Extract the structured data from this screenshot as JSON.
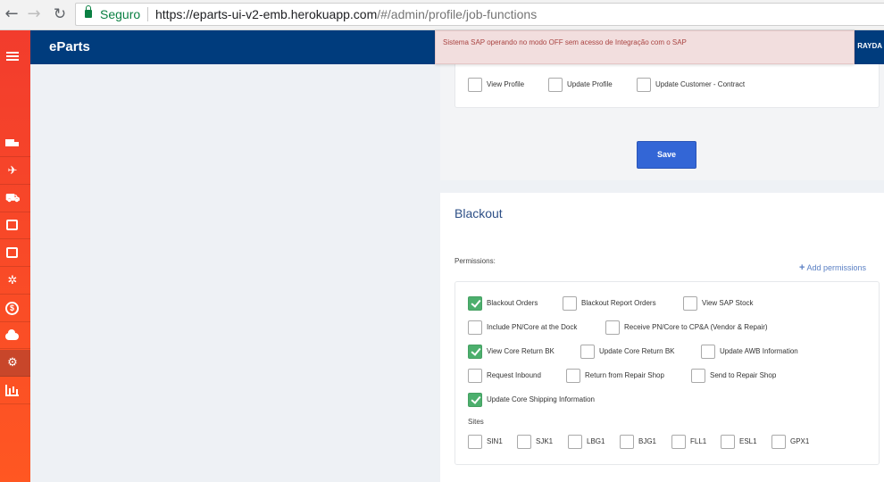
{
  "browser": {
    "secure_label": "Seguro",
    "url_host": "https://eparts-ui-v2-emb.herokuapp.com",
    "url_path": "/#/admin/profile/job-functions"
  },
  "header": {
    "logo": "eParts",
    "user": "RAYDA"
  },
  "alert": {
    "message": "Sistema SAP operando no modo OFF sem acesso de Integração com o SAP"
  },
  "sidebar": {
    "items": [
      {
        "icon": "truck-icon"
      },
      {
        "icon": "plane-icon"
      },
      {
        "icon": "cart-icon"
      },
      {
        "icon": "document-icon"
      },
      {
        "icon": "box-icon"
      },
      {
        "icon": "network-icon"
      },
      {
        "icon": "dollar-icon"
      },
      {
        "icon": "cloud-icon"
      },
      {
        "icon": "cogs-icon",
        "active": true
      },
      {
        "icon": "bar-chart-icon"
      }
    ]
  },
  "top_card": {
    "items": [
      {
        "label": "View Profile",
        "checked": false
      },
      {
        "label": "Update Profile",
        "checked": false
      },
      {
        "label": "Update Customer - Contract",
        "checked": false
      }
    ],
    "save_label": "Save"
  },
  "blackout": {
    "title": "Blackout",
    "permissions_label": "Permissions:",
    "add_permissions": "Add permissions",
    "permissions": [
      {
        "label": "Blackout Orders",
        "checked": true
      },
      {
        "label": "Blackout Report Orders",
        "checked": false
      },
      {
        "label": "View SAP Stock",
        "checked": false
      },
      {
        "label": "Include PN/Core at the Dock",
        "checked": false
      },
      {
        "label": "Receive PN/Core to CP&A (Vendor & Repair)",
        "checked": false
      },
      {
        "label": "View Core Return BK",
        "checked": true
      },
      {
        "label": "Update Core Return BK",
        "checked": false
      },
      {
        "label": "Update AWB Information",
        "checked": false
      },
      {
        "label": "Request Inbound",
        "checked": false
      },
      {
        "label": "Return from Repair Shop",
        "checked": false
      },
      {
        "label": "Send to Repair Shop",
        "checked": false
      },
      {
        "label": "Update Core Shipping Information",
        "checked": true
      }
    ],
    "sites_label": "Sites",
    "sites": [
      {
        "label": "SIN1",
        "checked": false
      },
      {
        "label": "SJK1",
        "checked": false
      },
      {
        "label": "LBG1",
        "checked": false
      },
      {
        "label": "BJG1",
        "checked": false
      },
      {
        "label": "FLL1",
        "checked": false
      },
      {
        "label": "ESL1",
        "checked": false
      },
      {
        "label": "GPX1",
        "checked": false
      }
    ]
  }
}
